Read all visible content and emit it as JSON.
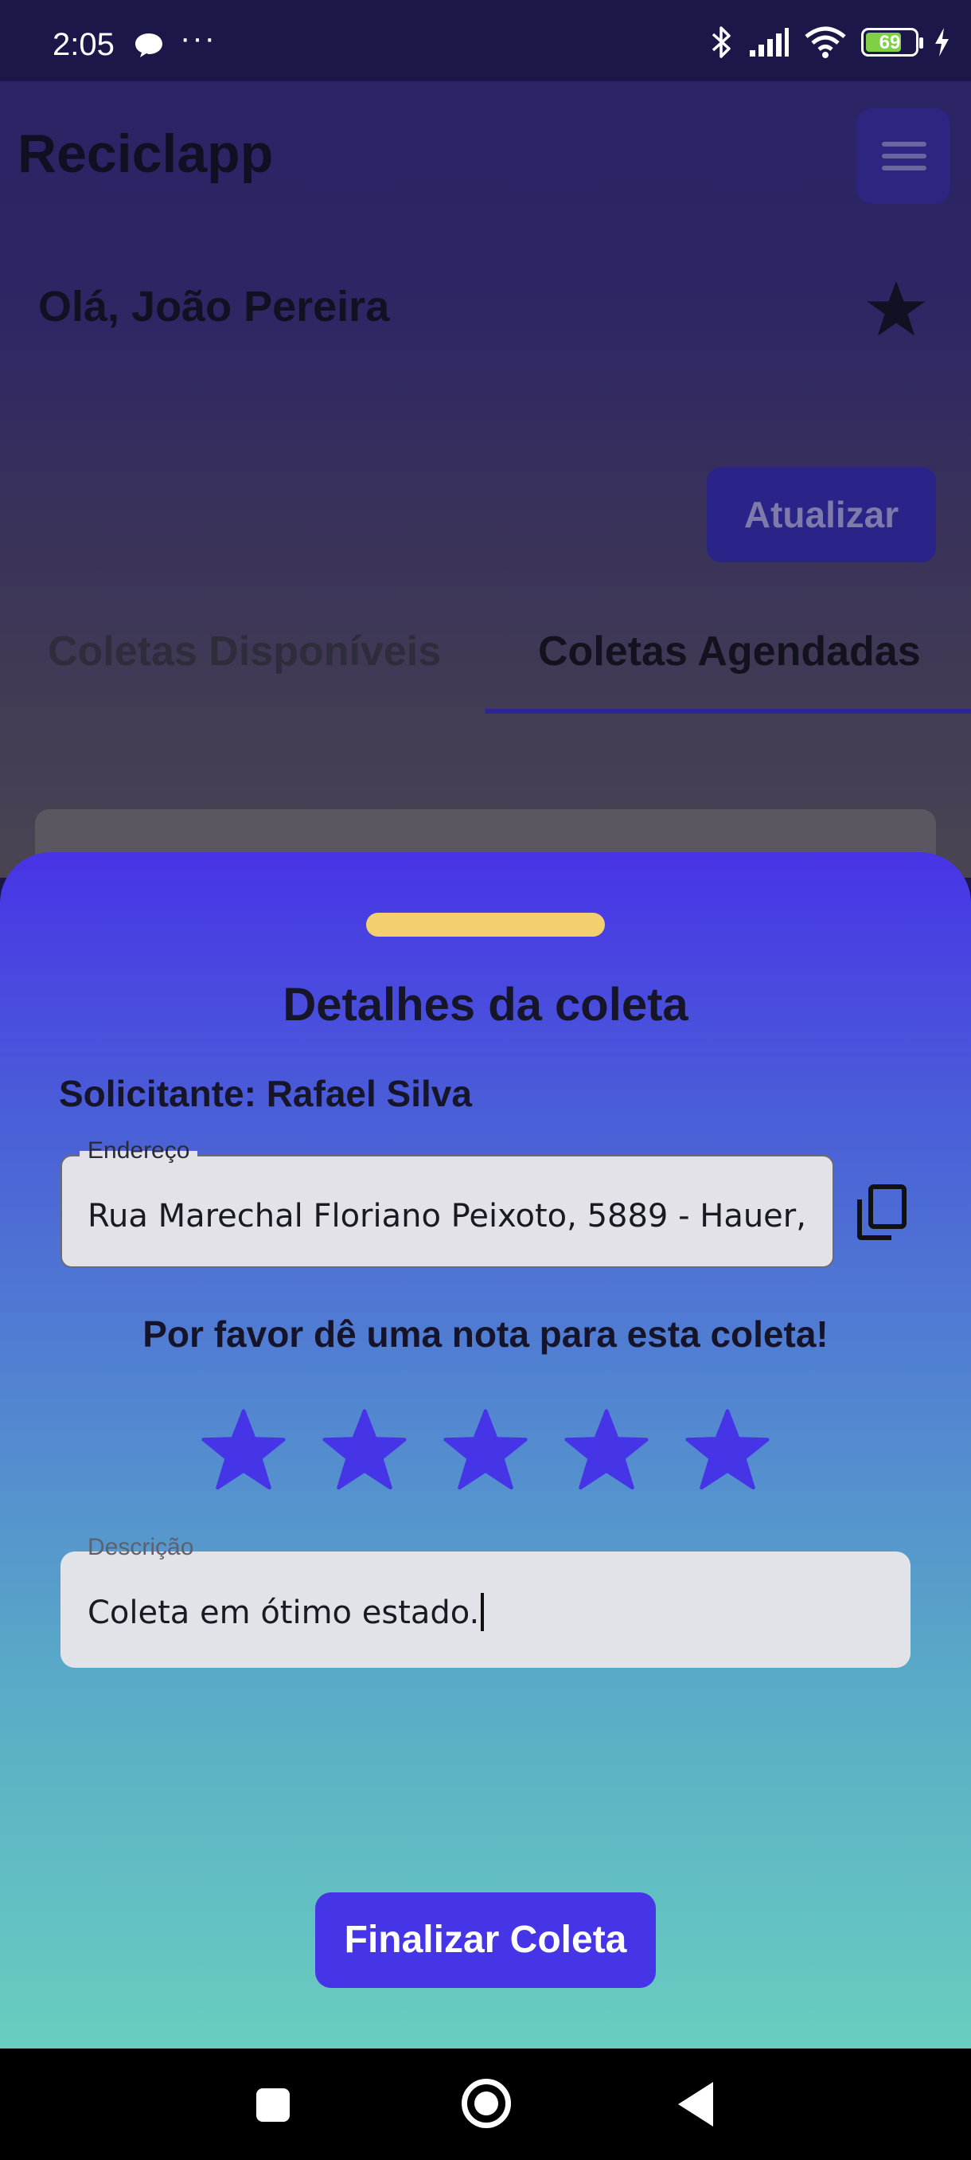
{
  "status_bar": {
    "time": "2:05",
    "dots": "···",
    "battery_level": "69",
    "icons": [
      "chat-bubble-icon",
      "bluetooth-icon",
      "signal-icon",
      "wifi-icon",
      "battery-icon",
      "charging-icon"
    ]
  },
  "app": {
    "title": "Reciclapp",
    "greeting": "Olá, João Pereira",
    "refresh_label": "Atualizar",
    "tabs": [
      {
        "label": "Coletas Disponíveis",
        "selected": false
      },
      {
        "label": "Coletas Agendadas",
        "selected": true
      }
    ]
  },
  "sheet": {
    "title": "Detalhes da coleta",
    "requester": "Solicitante: Rafael Silva",
    "address_label": "Endereço",
    "address_value": "Rua Marechal Floriano Peixoto, 5889 - Hauer,",
    "rating_prompt": "Por favor dê uma nota para esta coleta!",
    "rating": {
      "value": 5,
      "max": 5
    },
    "description_label": "Descrição",
    "description_value": "Coleta em ótimo estado.",
    "finish_label": "Finalizar Coleta"
  },
  "colors": {
    "accent": "#4535e6",
    "handle": "#f3cf6f",
    "gradient_top": "#4834e6",
    "gradient_bottom": "#69cebf",
    "star": "#4535e6"
  }
}
